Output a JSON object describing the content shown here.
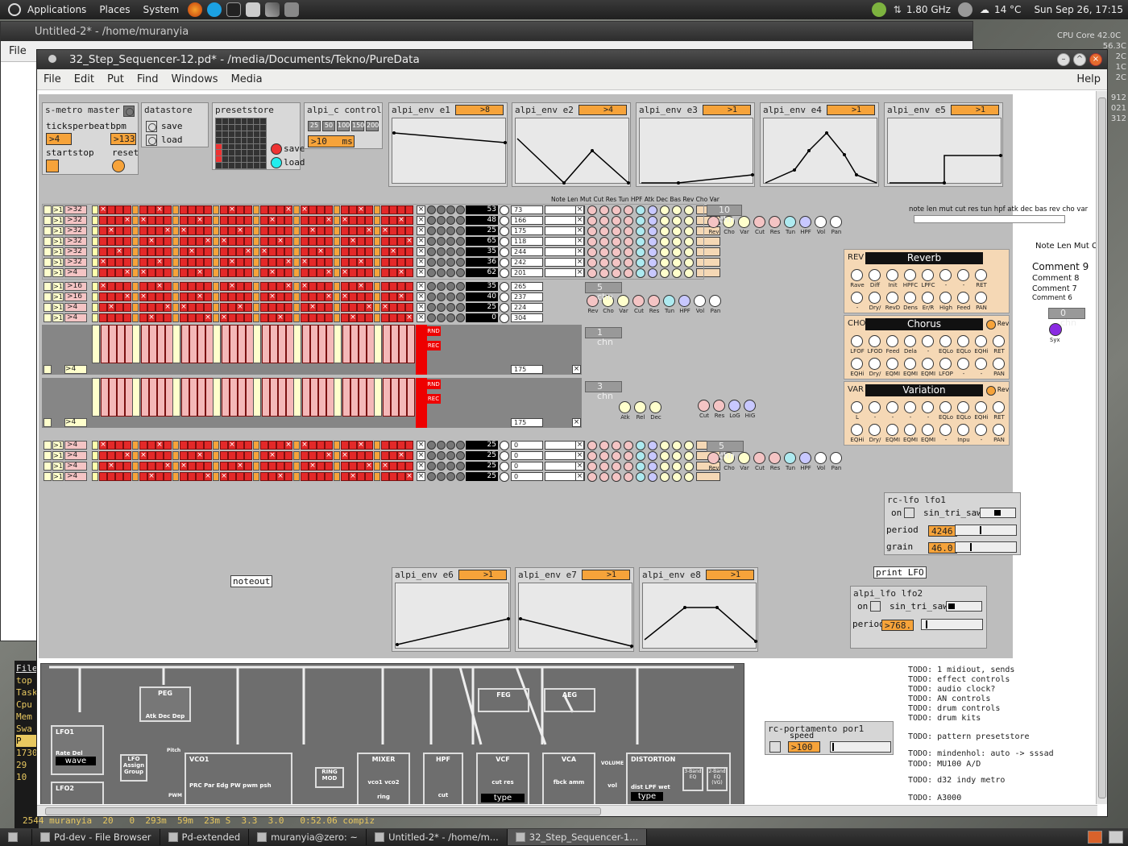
{
  "top_panel": {
    "menus": [
      "Applications",
      "Places",
      "System"
    ],
    "cpu_freq": "1.80 GHz",
    "weather": "14 °C",
    "clock": "Sun Sep 26, 17:15"
  },
  "cpu_widget": {
    "label": "CPU Core",
    "v1": "42.0C",
    "v2": "56.3C",
    "v3": "2C",
    "v4": "1C",
    "v5": "2C",
    "l1": "912",
    "l2": "021",
    "l3": "312"
  },
  "bg_window": {
    "title": "Untitled-2* - /home/muranyia",
    "menu_file": "File"
  },
  "terminal": {
    "lines": [
      "top",
      "Task",
      "Cpu",
      "Mem",
      "Swa",
      "",
      "P",
      "1730",
      "29",
      "10"
    ],
    "bottom_line": "2544 muranyia  20   0  293m  59m  23m S  3.3  3.0   0:52.06 compiz",
    "file_label": "File"
  },
  "pd_window": {
    "title": "32_Step_Sequencer-12.pd* - /media/Documents/Tekno/PureData",
    "menus": [
      "File",
      "Edit",
      "Put",
      "Find",
      "Windows",
      "Media"
    ],
    "help": "Help"
  },
  "smetro": {
    "title": "s-metro master",
    "ticks_label": "ticksperbeat",
    "ticks_value": ">4",
    "bpm_label": "bpm",
    "bpm_value": ">133",
    "startstop": "startstop",
    "reset": "reset"
  },
  "datastore": {
    "title": "datastore",
    "save": "save",
    "load": "load"
  },
  "presetstore": {
    "title": "presetstore",
    "save": "save",
    "load": "load"
  },
  "alpi_c": {
    "title": "alpi_c control",
    "buttons": [
      "25",
      "50",
      "100",
      "150",
      "200"
    ],
    "value": ">10",
    "unit": "ms"
  },
  "envelopes": [
    {
      "label": "alpi_env e1",
      "value": ">8"
    },
    {
      "label": "alpi_env e2",
      "value": ">4"
    },
    {
      "label": "alpi_env e3",
      "value": ">1"
    },
    {
      "label": "alpi_env e4",
      "value": ">1"
    },
    {
      "label": "alpi_env e5",
      "value": ">1"
    },
    {
      "label": "alpi_env e6",
      "value": ">1"
    },
    {
      "label": "alpi_env e7",
      "value": ">1"
    },
    {
      "label": "alpi_env e8",
      "value": ">1"
    }
  ],
  "header_labels": "Note Len Mut Cut Res Tun HPF Atk Dec Bas Rev Cho Var",
  "header_labels_right": "note len mut cut res tun hpf atk dec bas rev cho var",
  "note_len_mut": "Note Len Mut Cu",
  "group1": {
    "lens": [
      ">32",
      ">32",
      ">32",
      ">32",
      ">32",
      ">32",
      ">4"
    ],
    "notes": [
      "53",
      "48",
      "25",
      "65",
      "35",
      "36",
      "62"
    ],
    "times": [
      "73",
      "166",
      "175",
      "118",
      "244",
      "242",
      "201"
    ],
    "chn": "10 chn"
  },
  "group2": {
    "lens": [
      ">16",
      ">16",
      ">4",
      ">4"
    ],
    "notes": [
      "35",
      "40",
      "25",
      "0"
    ],
    "times": [
      "265",
      "237",
      "224",
      "304"
    ],
    "chn": "5 chn"
  },
  "group3": {
    "len": ">4",
    "time": "175",
    "chn": "1 chn",
    "rnd": "RND",
    "rec": "REC"
  },
  "group4": {
    "len": ">4",
    "time": "175",
    "chn": "3 chn",
    "rnd": "RND",
    "rec": "REC"
  },
  "group5": {
    "lens": [
      ">4",
      ">4",
      ">4",
      ">4"
    ],
    "notes": [
      "25",
      "25",
      "25",
      "25"
    ],
    "times": [
      "0",
      "0",
      "0",
      "0"
    ],
    "chn": "5 chn"
  },
  "knob_labels": [
    "Rev",
    "Cho",
    "Var",
    "Cut",
    "Res",
    "Tun",
    "HPF",
    "Vol",
    "Pan"
  ],
  "knob_labels_5": [
    "Rev",
    "Cho",
    "Var",
    "Cut",
    "Res",
    "Tun",
    "HPF",
    "Vol",
    "Pan"
  ],
  "extra_knobs_a": [
    "Atk",
    "Rel",
    "Dec"
  ],
  "extra_knobs_b": [
    "Cut",
    "Res",
    "LoG",
    "HiG"
  ],
  "reverb": {
    "tag": "REV",
    "title": "Reverb",
    "row1": [
      "Rave",
      "Diff",
      "Init",
      "HPFC",
      "LPFC",
      "-",
      "-",
      "RET"
    ],
    "row2": [
      "-",
      "Dry/",
      "RevD",
      "Dens",
      "Er/R",
      "High",
      "Feed",
      "PAN"
    ]
  },
  "chorus": {
    "tag": "CHO",
    "title": "Chorus",
    "rev": "Rev",
    "row1": [
      "LFOF",
      "LFOD",
      "Feed",
      "Dela",
      "-",
      "EQLo",
      "EQLo",
      "EQHi",
      "RET"
    ],
    "row2": [
      "EQHi",
      "Dry/",
      "EQMI",
      "EQMI",
      "EQMI",
      "LFOP",
      "-",
      "-",
      "PAN"
    ]
  },
  "variation": {
    "tag": "VAR",
    "title": "Variation",
    "rev": "Rev",
    "row1": [
      "L",
      "-",
      "-",
      "-",
      "-",
      "EQLo",
      "EQLo",
      "EQHi",
      "RET"
    ],
    "row2": [
      "EQHi",
      "Dry/",
      "EQMI",
      "EQMI",
      "EQMI",
      "-",
      "Inpu",
      "-",
      "PAN"
    ]
  },
  "comments": {
    "c9": "Comment 9",
    "c8": "Comment 8",
    "c7": "Comment 7",
    "c6": "Comment 6"
  },
  "chn0": {
    "label": "0 chn",
    "syx": "Syx"
  },
  "lfo1": {
    "title": "rc-lfo lfo1",
    "on": "on",
    "wave": "sin_tri_saw",
    "period_label": "period",
    "period": "4246",
    "grain_label": "grain",
    "grain": "46.0"
  },
  "print_lfo": "print LFO",
  "lfo2": {
    "title": "alpi_lfo lfo2",
    "on": "on",
    "wave": "sin_tri_saw",
    "period_label": "period",
    "period": ">768."
  },
  "noteout": "noteout",
  "portamento": {
    "title": "rc-portamento por1",
    "speed_label": "speed",
    "speed": ">100"
  },
  "todos": [
    "TODO: 1 midiout, sends",
    "TODO: effect controls",
    "TODO: audio clock?",
    "TODO: AN controls",
    "TODO: drum controls",
    "TODO: drum kits",
    "TODO: pattern presetstore",
    "TODO: mindenhol: auto -> sssad",
    "TODO: MU100 A/D",
    "TODO: d32 indy metro",
    "TODO: A3000"
  ],
  "synth": {
    "peg": "PEG",
    "feg": "FEG",
    "aeg": "AEG",
    "lfo1": "LFO1",
    "lfo1_knobs": "Rate Del",
    "wave": "wave",
    "lfo2": "LFO2",
    "lfo_assign": "LFO Assign Group",
    "vco1": "VCO1",
    "vco1_knobs": "PRC Par Edg PW pwm psh",
    "ring": "RING MOD",
    "mixer": "MIXER",
    "mixer_knobs": "vco1 vco2",
    "ring_knob": "ring",
    "hpf": "HPF",
    "hpf_knob": "cut",
    "vcf": "VCF",
    "vcf_knobs": "cut res",
    "vcf_type": "type",
    "vca": "VCA",
    "vca_knobs": "fbck amm",
    "volume": "VOLUME",
    "vol_knob": "vol",
    "distortion": "DISTORTION",
    "dist_knobs": "dist LPF wet",
    "dist_type": "type",
    "peg_knobs": "Atk Dec Dep",
    "pitch": "Pitch",
    "pwm": "PWM",
    "eq3": "3-Band EQ",
    "eq2": "2-Band EQ (VG)"
  },
  "taskbar": {
    "items": [
      "Pd-dev - File Browser",
      "Pd-extended",
      "muranyia@zero: ~",
      "Untitled-2* - /home/m...",
      "32_Step_Sequencer-1..."
    ]
  }
}
